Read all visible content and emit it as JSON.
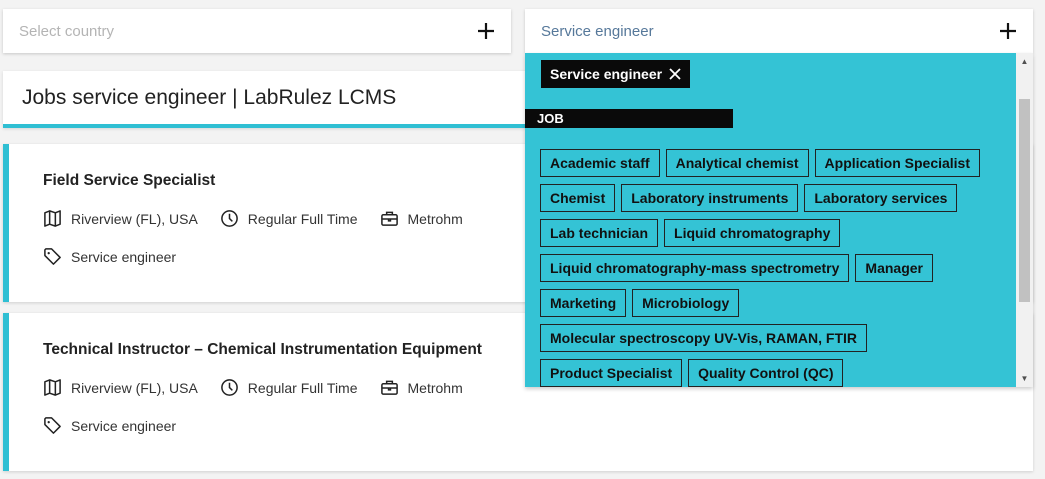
{
  "country_select": {
    "placeholder": "Select country"
  },
  "tag_select": {
    "value": "Service engineer"
  },
  "page_title": "Jobs service engineer | LabRulez LCMS",
  "jobs": [
    {
      "title": "Field Service Specialist",
      "location": "Riverview (FL), USA",
      "type": "Regular Full Time",
      "company": "Metrohm",
      "tag": "Service engineer"
    },
    {
      "title": "Technical Instructor – Chemical Instrumentation Equipment",
      "location": "Riverview (FL), USA",
      "type": "Regular Full Time",
      "company": "Metrohm",
      "tag": "Service engineer"
    }
  ],
  "dropdown": {
    "selected": "Service engineer",
    "group_label": "JOB",
    "options": [
      "Academic staff",
      "Analytical chemist",
      "Application Specialist",
      "Chemist",
      "Laboratory instruments",
      "Laboratory services",
      "Lab technician",
      "Liquid chromatography",
      "Liquid chromatography-mass spectrometry",
      "Manager",
      "Marketing",
      "Microbiology",
      "Molecular spectroscopy UV-Vis, RAMAN, FTIR",
      "Product Specialist",
      "Quality Control (QC)"
    ]
  },
  "icons": {
    "add": "plus-icon",
    "remove": "close-icon",
    "location": "map-icon",
    "type": "clock-icon",
    "company": "briefcase-icon",
    "tag": "tag-icon"
  },
  "colors": {
    "accent": "#2fbfd3",
    "dropdown_bg": "#34c3d5",
    "chip_bg": "#0a0a0a"
  }
}
